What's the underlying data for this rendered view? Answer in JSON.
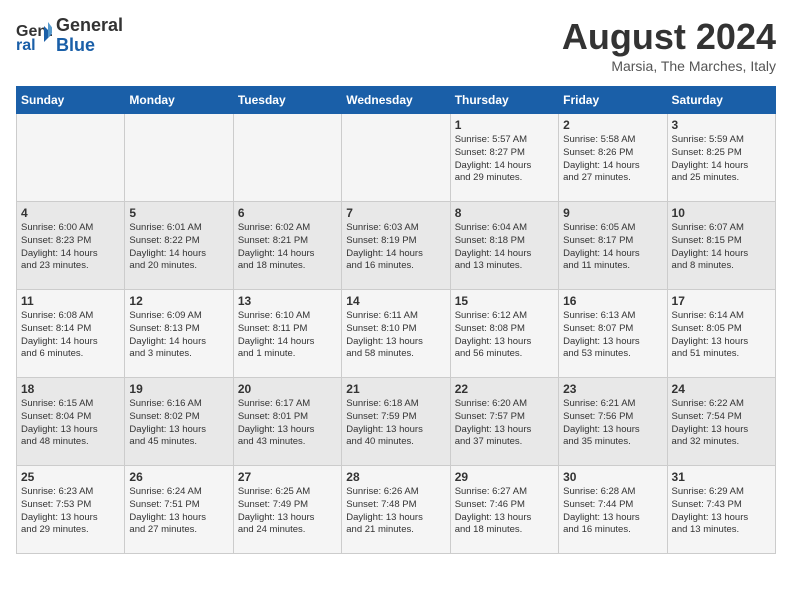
{
  "header": {
    "logo_line1": "General",
    "logo_line2": "Blue",
    "month_year": "August 2024",
    "location": "Marsia, The Marches, Italy"
  },
  "days_of_week": [
    "Sunday",
    "Monday",
    "Tuesday",
    "Wednesday",
    "Thursday",
    "Friday",
    "Saturday"
  ],
  "weeks": [
    [
      {
        "day": "",
        "info": ""
      },
      {
        "day": "",
        "info": ""
      },
      {
        "day": "",
        "info": ""
      },
      {
        "day": "",
        "info": ""
      },
      {
        "day": "1",
        "info": "Sunrise: 5:57 AM\nSunset: 8:27 PM\nDaylight: 14 hours\nand 29 minutes."
      },
      {
        "day": "2",
        "info": "Sunrise: 5:58 AM\nSunset: 8:26 PM\nDaylight: 14 hours\nand 27 minutes."
      },
      {
        "day": "3",
        "info": "Sunrise: 5:59 AM\nSunset: 8:25 PM\nDaylight: 14 hours\nand 25 minutes."
      }
    ],
    [
      {
        "day": "4",
        "info": "Sunrise: 6:00 AM\nSunset: 8:23 PM\nDaylight: 14 hours\nand 23 minutes."
      },
      {
        "day": "5",
        "info": "Sunrise: 6:01 AM\nSunset: 8:22 PM\nDaylight: 14 hours\nand 20 minutes."
      },
      {
        "day": "6",
        "info": "Sunrise: 6:02 AM\nSunset: 8:21 PM\nDaylight: 14 hours\nand 18 minutes."
      },
      {
        "day": "7",
        "info": "Sunrise: 6:03 AM\nSunset: 8:19 PM\nDaylight: 14 hours\nand 16 minutes."
      },
      {
        "day": "8",
        "info": "Sunrise: 6:04 AM\nSunset: 8:18 PM\nDaylight: 14 hours\nand 13 minutes."
      },
      {
        "day": "9",
        "info": "Sunrise: 6:05 AM\nSunset: 8:17 PM\nDaylight: 14 hours\nand 11 minutes."
      },
      {
        "day": "10",
        "info": "Sunrise: 6:07 AM\nSunset: 8:15 PM\nDaylight: 14 hours\nand 8 minutes."
      }
    ],
    [
      {
        "day": "11",
        "info": "Sunrise: 6:08 AM\nSunset: 8:14 PM\nDaylight: 14 hours\nand 6 minutes."
      },
      {
        "day": "12",
        "info": "Sunrise: 6:09 AM\nSunset: 8:13 PM\nDaylight: 14 hours\nand 3 minutes."
      },
      {
        "day": "13",
        "info": "Sunrise: 6:10 AM\nSunset: 8:11 PM\nDaylight: 14 hours\nand 1 minute."
      },
      {
        "day": "14",
        "info": "Sunrise: 6:11 AM\nSunset: 8:10 PM\nDaylight: 13 hours\nand 58 minutes."
      },
      {
        "day": "15",
        "info": "Sunrise: 6:12 AM\nSunset: 8:08 PM\nDaylight: 13 hours\nand 56 minutes."
      },
      {
        "day": "16",
        "info": "Sunrise: 6:13 AM\nSunset: 8:07 PM\nDaylight: 13 hours\nand 53 minutes."
      },
      {
        "day": "17",
        "info": "Sunrise: 6:14 AM\nSunset: 8:05 PM\nDaylight: 13 hours\nand 51 minutes."
      }
    ],
    [
      {
        "day": "18",
        "info": "Sunrise: 6:15 AM\nSunset: 8:04 PM\nDaylight: 13 hours\nand 48 minutes."
      },
      {
        "day": "19",
        "info": "Sunrise: 6:16 AM\nSunset: 8:02 PM\nDaylight: 13 hours\nand 45 minutes."
      },
      {
        "day": "20",
        "info": "Sunrise: 6:17 AM\nSunset: 8:01 PM\nDaylight: 13 hours\nand 43 minutes."
      },
      {
        "day": "21",
        "info": "Sunrise: 6:18 AM\nSunset: 7:59 PM\nDaylight: 13 hours\nand 40 minutes."
      },
      {
        "day": "22",
        "info": "Sunrise: 6:20 AM\nSunset: 7:57 PM\nDaylight: 13 hours\nand 37 minutes."
      },
      {
        "day": "23",
        "info": "Sunrise: 6:21 AM\nSunset: 7:56 PM\nDaylight: 13 hours\nand 35 minutes."
      },
      {
        "day": "24",
        "info": "Sunrise: 6:22 AM\nSunset: 7:54 PM\nDaylight: 13 hours\nand 32 minutes."
      }
    ],
    [
      {
        "day": "25",
        "info": "Sunrise: 6:23 AM\nSunset: 7:53 PM\nDaylight: 13 hours\nand 29 minutes."
      },
      {
        "day": "26",
        "info": "Sunrise: 6:24 AM\nSunset: 7:51 PM\nDaylight: 13 hours\nand 27 minutes."
      },
      {
        "day": "27",
        "info": "Sunrise: 6:25 AM\nSunset: 7:49 PM\nDaylight: 13 hours\nand 24 minutes."
      },
      {
        "day": "28",
        "info": "Sunrise: 6:26 AM\nSunset: 7:48 PM\nDaylight: 13 hours\nand 21 minutes."
      },
      {
        "day": "29",
        "info": "Sunrise: 6:27 AM\nSunset: 7:46 PM\nDaylight: 13 hours\nand 18 minutes."
      },
      {
        "day": "30",
        "info": "Sunrise: 6:28 AM\nSunset: 7:44 PM\nDaylight: 13 hours\nand 16 minutes."
      },
      {
        "day": "31",
        "info": "Sunrise: 6:29 AM\nSunset: 7:43 PM\nDaylight: 13 hours\nand 13 minutes."
      }
    ]
  ]
}
